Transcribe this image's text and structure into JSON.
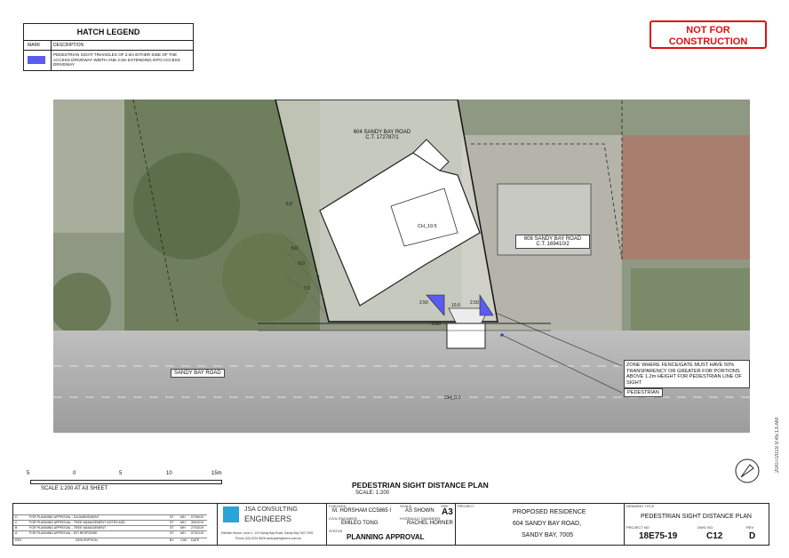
{
  "legend": {
    "title": "HATCH LEGEND",
    "col_mark": "MARK",
    "col_description": "DESCRIPTION",
    "row_description": "PEDESTRIAN SIGHT TRIANGLES OF 2.0m EITHER SIDE OF THE ACCESS DRIVEWAY WIDTH AND 2.5m EXTENDING INTO ACCESS DRIVEWAY",
    "swatch_color": "#5b5bf0"
  },
  "stamp": {
    "line1": "NOT FOR",
    "line2": "CONSTRUCTION",
    "color": "#dd1111"
  },
  "plan": {
    "lot_604": "604 SANDY BAY ROAD",
    "lot_604_ct": "C.T. 172787/1",
    "lot_608": "608 SANDY BAY ROAD",
    "lot_608_ct": "C.T. 169410/2",
    "ch_19_5": "CH_19.5",
    "ch_0_0": "CH_0.0",
    "road": "SANDY BAY ROAD",
    "dim_2_50a": "2.50",
    "dim_2_50b": "2.50",
    "dim_10_0": "10.0",
    "dim_2_00": "2.00",
    "note_zone": "ZONE WHERE FENCE/GATE MUST HAVE 50% TRANSPARENCY OR GREATER FOR PORTIONS ABOVE 1.2m HEIGHT FOR PEDESTRIAN LINE OF SIGHT",
    "note_ped": "PEDESTRIAN",
    "contours": [
      "5.0",
      "6.0",
      "7.0",
      "6.0"
    ]
  },
  "scale": {
    "t0": "5",
    "t1": "0",
    "t2": "5",
    "t3": "10",
    "t4": "15m",
    "caption": "SCALE 1:200 AT A3 SHEET"
  },
  "drawing": {
    "title": "PEDESTRIAN SIGHT DISTANCE PLAN",
    "subtitle": "SCALE:  1:200"
  },
  "title_block": {
    "revisions": [
      {
        "rev": "D",
        "desc": "FOR PLANNING APPROVAL - DA AMENDMENT",
        "by": "ST",
        "chk": "MH",
        "date": "07/06/19"
      },
      {
        "rev": "C",
        "desc": "FOR PLANNING APPROVAL - TREE MANAGEMENT NOTES ADD",
        "by": "ST",
        "chk": "MH",
        "date": "30/03/19"
      },
      {
        "rev": "B",
        "desc": "FOR PLANNING APPROVAL - TREE MANAGEMENT",
        "by": "ST",
        "chk": "MH",
        "date": "27/03/19"
      },
      {
        "rev": "A",
        "desc": "FOR PLANNING APPROVAL - RFI RESPONSE",
        "by": "ST",
        "chk": "MH",
        "date": "07/01/19"
      }
    ],
    "rev_header": {
      "rev": "REV",
      "desc": "DESCRIPTION",
      "by": "BY",
      "chk": "CHK",
      "date": "DATE"
    },
    "company_line1": "JSA CONSULTING",
    "company_line2": "ENGINEERS",
    "address": "Ellerslie House, Level 1, 119 Sandy Bay Road, Sandy Bay TAS 7005",
    "phone": "Phone (03) 6224 5626     www.jsaengineers.com.au",
    "checked_label": "CHECKED",
    "checked": "M. HORSHAM CC5865 I",
    "scale_label": "SCALE",
    "scale_val": "AS SHOWN",
    "size_label": "SIZE",
    "size": "A3",
    "civil_label": "CIVIL ENGINEER",
    "civil": "EMILEO TONG",
    "hydraulic_label": "HYDRAULIC ENGINEER",
    "hydraulic": "RACHEL HORNER",
    "status_label": "STATUS",
    "status": "PLANNING APPROVAL",
    "project_label": "PROJECT",
    "project1": "PROPOSED RESIDENCE",
    "project2": "604 SANDY BAY ROAD,",
    "project3": "SANDY BAY, 7005",
    "dt_label": "DRAWING TITLE",
    "drawing_title": "PEDESTRIAN SIGHT DISTANCE PLAN",
    "projno_label": "PROJECT NO",
    "projno": "18E75-19",
    "dwgno_label": "DWG NO",
    "dwgno": "C12",
    "rev_label": "REV",
    "rev": "D"
  },
  "timestamp": "20/07/2019 9:45:13 AM"
}
